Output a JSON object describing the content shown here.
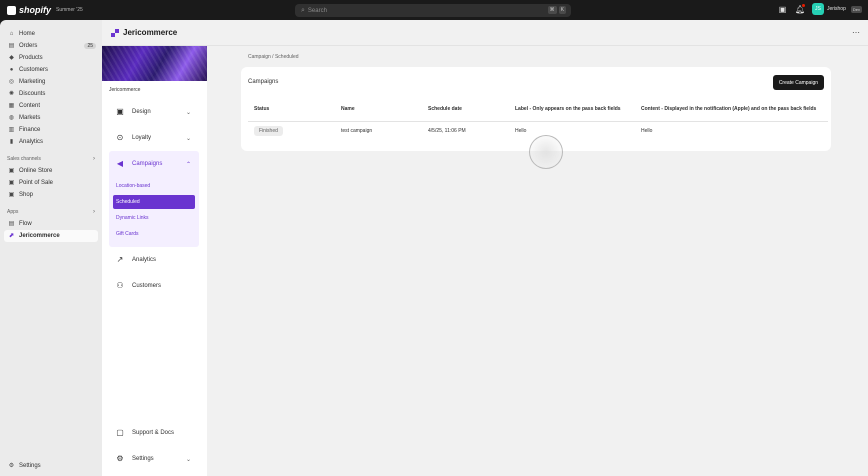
{
  "topbar": {
    "brand": "shopify",
    "edition": "Summer '25",
    "search_placeholder": "Search",
    "shortcut_keys": [
      "⌘",
      "K"
    ],
    "store_initials": "JS",
    "store_name": "Jerishop",
    "store_badge": "Dev"
  },
  "admin_nav": {
    "items": [
      {
        "label": "Home",
        "icon": "home-icon"
      },
      {
        "label": "Orders",
        "icon": "orders-icon",
        "count": "25"
      },
      {
        "label": "Products",
        "icon": "tag-icon"
      },
      {
        "label": "Customers",
        "icon": "person-icon"
      },
      {
        "label": "Marketing",
        "icon": "target-icon"
      },
      {
        "label": "Discounts",
        "icon": "discount-icon"
      },
      {
        "label": "Content",
        "icon": "content-icon"
      },
      {
        "label": "Markets",
        "icon": "globe-icon"
      },
      {
        "label": "Finance",
        "icon": "bank-icon"
      },
      {
        "label": "Analytics",
        "icon": "chart-icon"
      }
    ],
    "sales_channels_label": "Sales channels",
    "sales_channels": [
      {
        "label": "Online Store",
        "icon": "store-icon"
      },
      {
        "label": "Point of Sale",
        "icon": "pos-icon"
      },
      {
        "label": "Shop",
        "icon": "shop-icon"
      }
    ],
    "apps_label": "Apps",
    "apps": [
      {
        "label": "Flow",
        "icon": "flow-icon"
      },
      {
        "label": "Jericommerce",
        "icon": "jericommerce-icon"
      }
    ],
    "settings_label": "Settings"
  },
  "app": {
    "title": "Jericommerce",
    "store_name": "Jericommerce",
    "sidebar": {
      "design": "Design",
      "loyalty": "Loyalty",
      "campaigns": "Campaigns",
      "campaign_items": [
        "Location-based",
        "Scheduled",
        "Dynamic Links",
        "Gift Cards"
      ],
      "analytics": "Analytics",
      "customers": "Customers",
      "support": "Support & Docs",
      "settings": "Settings"
    }
  },
  "content": {
    "breadcrumb": "Campaign / Scheduled",
    "card_title": "Campaigns",
    "create_button": "Create Campaign",
    "table": {
      "headers": [
        "Status",
        "Name",
        "Schedule date",
        "Label - Only appears on the pass back fields",
        "Content - Displayed in the notification (Apple) and on the pass back fields"
      ],
      "rows": [
        [
          "Finished",
          "test campaign",
          "4/5/25, 11:06 PM",
          "Hello",
          "Hello"
        ]
      ]
    }
  },
  "colors": {
    "accent": "#6a34d0",
    "topbar": "#1a1a1a",
    "page_bg": "#f1f1f1"
  }
}
